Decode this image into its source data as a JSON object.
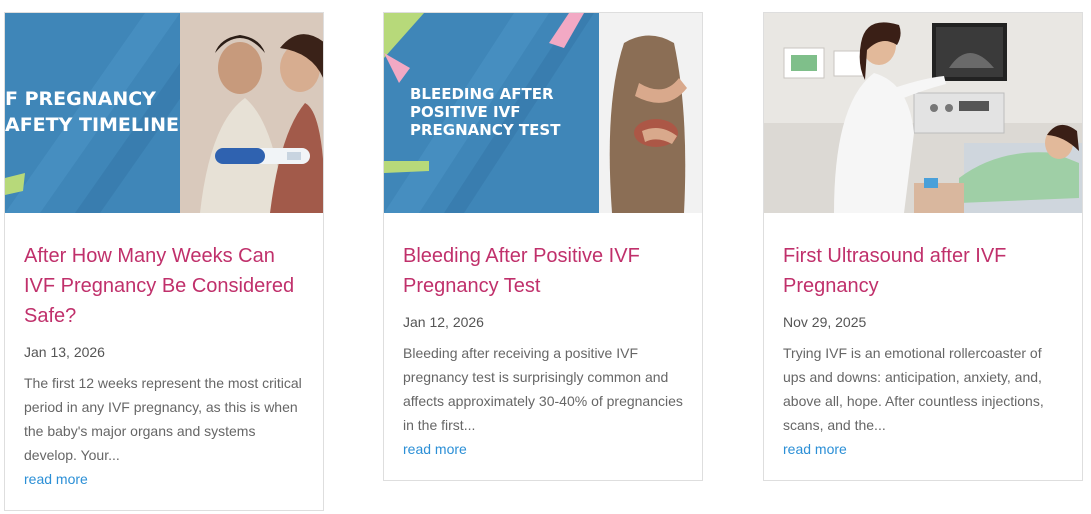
{
  "posts": [
    {
      "image_overlay_lines": [
        "F PREGNANCY",
        "AFETY TIMELINE"
      ],
      "title": "After How Many Weeks Can IVF Pregnancy Be Considered Safe?",
      "date": "Jan 13, 2026",
      "excerpt": "The first 12 weeks represent the most critical period in any IVF pregnancy, as this is when the baby's major organs and systems develop. Your...",
      "more": "read more"
    },
    {
      "image_overlay_lines": [
        "BLEEDING AFTER",
        "POSITIVE IVF",
        "PREGNANCY TEST"
      ],
      "title": "Bleeding After Positive IVF Pregnancy Test",
      "date": "Jan 12, 2026",
      "excerpt": "Bleeding after receiving a positive IVF pregnancy test is surprisingly common and affects approximately 30-40% of pregnancies in the first...",
      "more": "read more"
    },
    {
      "title": "First Ultrasound after IVF Pregnancy",
      "date": "Nov 29, 2025",
      "excerpt": "Trying IVF is an emotional rollercoaster of ups and downs: anticipation, anxiety, and, above all, hope. After countless injections, scans, and the...",
      "more": "read more"
    }
  ],
  "colors": {
    "title": "#c0306b",
    "link": "#2b8fd6",
    "banner_blue": "#3f86b8"
  }
}
